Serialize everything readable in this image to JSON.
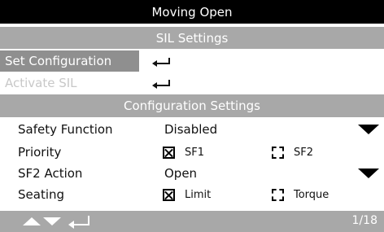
{
  "header": {
    "title": "Moving Open"
  },
  "sil_section": {
    "title": "SIL Settings"
  },
  "menu": [
    {
      "label": "Set Configuration",
      "state": "selected"
    },
    {
      "label": "Activate SIL",
      "state": "disabled"
    }
  ],
  "config_section": {
    "title": "Configuration Settings"
  },
  "settings": {
    "safety_function": {
      "label": "Safety Function",
      "value": "Disabled"
    },
    "priority": {
      "label": "Priority",
      "options": [
        {
          "label": "SF1",
          "checked": true
        },
        {
          "label": "SF2",
          "checked": false
        }
      ]
    },
    "sf2_action": {
      "label": "SF2 Action",
      "value": "Open"
    },
    "seating": {
      "label": "Seating",
      "options": [
        {
          "label": "Limit",
          "checked": true
        },
        {
          "label": "Torque",
          "checked": false
        }
      ]
    }
  },
  "footer": {
    "page_indicator": "1/18"
  },
  "icons": [
    "enter-icon",
    "dropdown-arrow-icon",
    "checkbox-checked-icon",
    "checkbox-unchecked-icon",
    "up-arrow-icon",
    "down-arrow-icon"
  ],
  "colors": {
    "title_bar": "#000000",
    "section_bar": "#a8a8a8",
    "selected_row": "#8f8f8f",
    "disabled_text": "#c8c8c8"
  }
}
